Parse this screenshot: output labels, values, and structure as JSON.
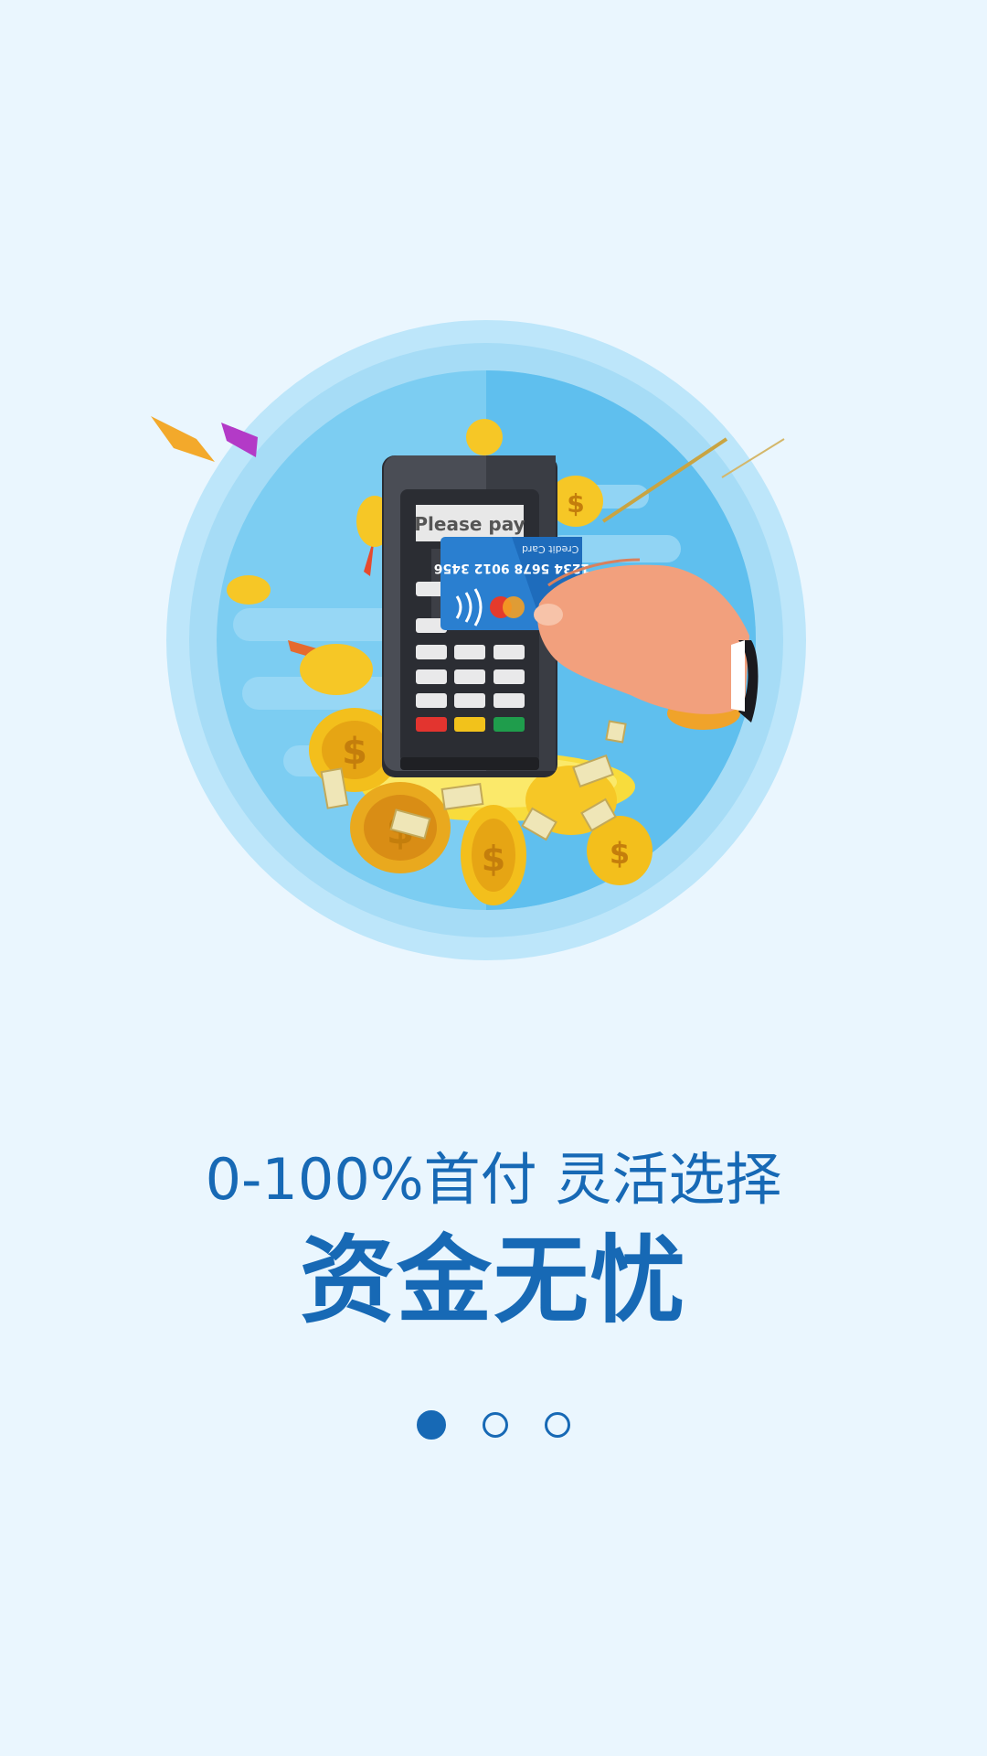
{
  "onboarding": {
    "subtitle": "0-100%首付  灵活选择",
    "headline": "资金无忧",
    "pages": [
      {
        "active": true
      },
      {
        "active": false
      },
      {
        "active": false
      }
    ]
  },
  "illustration": {
    "terminal_prompt": "Please pay",
    "card_number": "1234 5678 9012 3456",
    "card_label": "Credit Card",
    "coin_symbol": "$"
  },
  "colors": {
    "background": "#eaf6fe",
    "accent": "#1769b5",
    "circle_light": "#bde6fa",
    "circle_inner": "#6ec8f0",
    "coin": "#f5c21b"
  }
}
